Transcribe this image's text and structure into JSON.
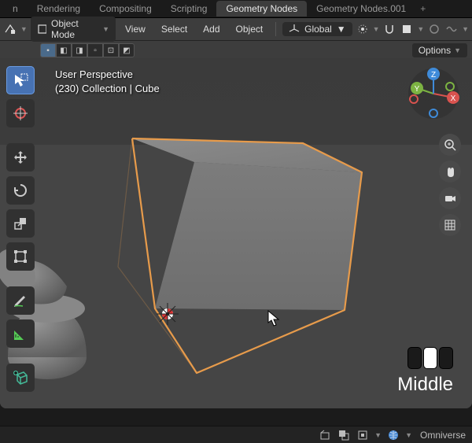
{
  "tabs": {
    "items": [
      "n",
      "Rendering",
      "Compositing",
      "Scripting",
      "Geometry Nodes",
      "Geometry Nodes.001"
    ],
    "active_index": 4,
    "add_label": "+"
  },
  "header": {
    "mode": "Object Mode",
    "menus": [
      "View",
      "Select",
      "Add",
      "Object"
    ],
    "orientation_icon": "axes",
    "orientation": "Global"
  },
  "shade": {
    "options_label": "Options"
  },
  "viewport": {
    "perspective_line1": "User Perspective",
    "perspective_line2": "(230) Collection | Cube",
    "mouse_hint": "Middle"
  },
  "tools": {
    "t0": "select-box",
    "t1": "cursor",
    "t2": "move",
    "t3": "rotate",
    "t4": "scale",
    "t5": "transform",
    "t6": "annotate",
    "t7": "measure",
    "t8": "add"
  },
  "nav": {
    "n0": "zoom",
    "n1": "pan",
    "n2": "camera",
    "n3": "grid"
  },
  "footer": {
    "engine": "Omniverse"
  }
}
